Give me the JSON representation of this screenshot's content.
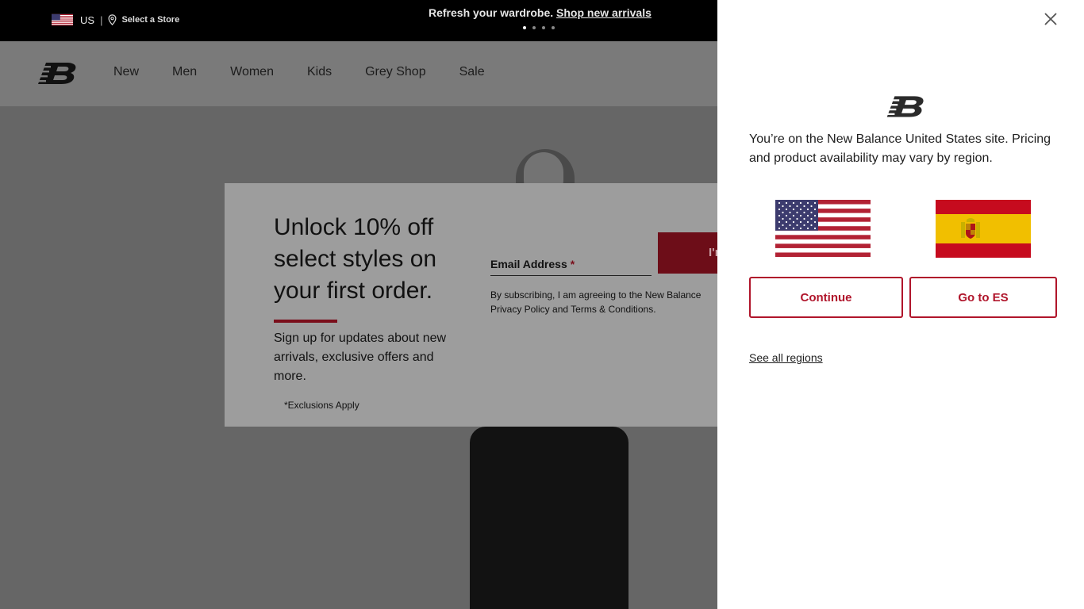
{
  "topbar": {
    "country_code": "US",
    "separator": "|",
    "store_label": "Select a Store",
    "promo_text": "Refresh your wardrobe.",
    "promo_link": "Shop new arrivals",
    "carousel_total": 4,
    "carousel_active": 1
  },
  "nav": {
    "items": [
      "New",
      "Men",
      "Women",
      "Kids",
      "Grey Shop",
      "Sale"
    ]
  },
  "signup": {
    "headline": "Unlock 10% off select styles on your first order.",
    "subtext": "Sign up for updates about new arrivals, exclusive offers and more.",
    "exclusions": "*Exclusions Apply",
    "email_label": "Email Address",
    "required_mark": "*",
    "button_label": "I'm in",
    "consent": "By subscribing, I am agreeing to the New Balance Privacy Policy and Terms & Conditions."
  },
  "region_panel": {
    "message": "You’re on the New Balance United States site. Pricing and product availability may vary by region.",
    "continue_label": "Continue",
    "go_label": "Go to ES",
    "see_all_label": "See all regions"
  },
  "colors": {
    "brand_red": "#b0152b",
    "signup_button": "#6d0d18",
    "topbar": "#000000",
    "panel": "#ffffff"
  },
  "icons": [
    "us-flag-icon",
    "map-pin-icon",
    "nb-logo-icon",
    "close-icon",
    "spain-flag-icon"
  ]
}
